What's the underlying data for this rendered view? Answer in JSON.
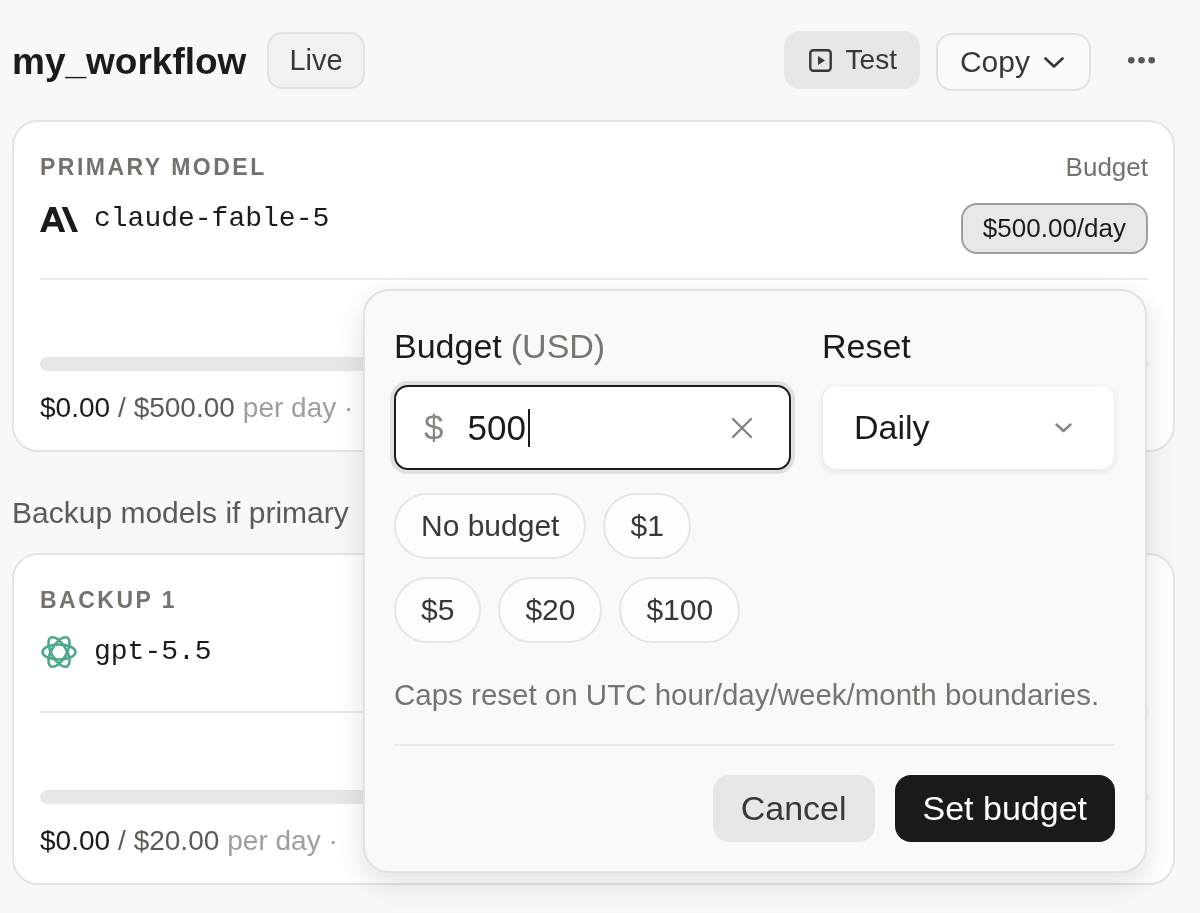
{
  "header": {
    "title": "my_workflow",
    "status": "Live",
    "actions": [
      {
        "kind": "test",
        "label": "Test"
      },
      {
        "kind": "dropdown",
        "label": "Copy"
      },
      {
        "kind": "more"
      }
    ]
  },
  "primary": {
    "label": "PRIMARY MODEL",
    "model": "claude-fable-5",
    "budget_label": "Budget",
    "budget": "$500.00/day",
    "usage": {
      "level": 0,
      "spent": "$0.00",
      "limit": "/ $500.00",
      "period": "per day ·"
    }
  },
  "backup_heading": "Backup models if primary",
  "backups": [
    {
      "label": "BACKUP 1",
      "model": "gpt-5.5",
      "usage": {
        "level": 0,
        "spent": "$0.00",
        "limit": "/ $20.00",
        "period": "per day ·"
      }
    }
  ],
  "budget_popover": {
    "amount_label": "Budget",
    "amount_unit": "(USD)",
    "reset_label": "Reset",
    "amount_field": {
      "prefix": "$",
      "value": "500",
      "focused": true
    },
    "reset_select": {
      "value": "Daily"
    },
    "preset_rows": [
      [
        "No budget",
        "$1"
      ],
      [
        "$5",
        "$20",
        "$100"
      ]
    ],
    "hint": "Caps reset on UTC hour/day/week/month boundaries.",
    "buttons": [
      {
        "kind": "secondary",
        "label": "Cancel"
      },
      {
        "kind": "primary",
        "label": "Set budget"
      }
    ]
  }
}
